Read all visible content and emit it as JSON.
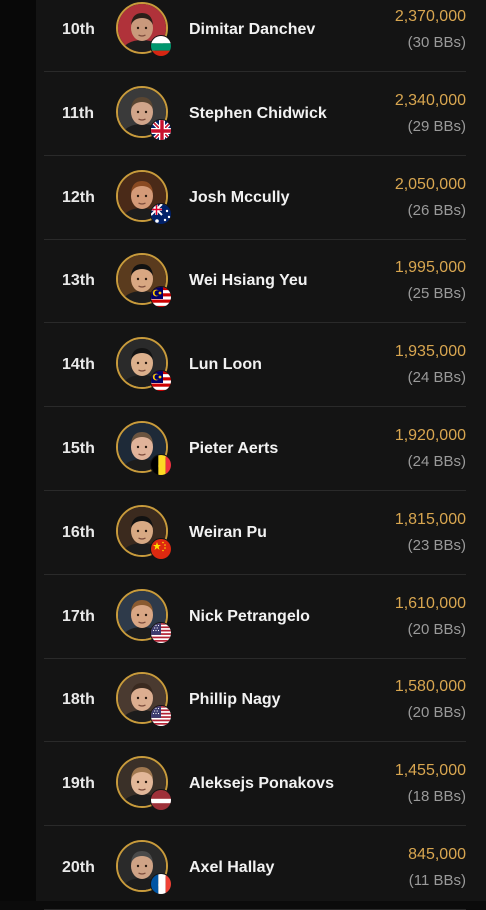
{
  "leaderboard": {
    "rows": [
      {
        "rank": "10th",
        "name": "Dimitar Danchev",
        "chips": "2,370,000",
        "bbs": "(30 BBs)",
        "flag": "bulgaria",
        "skin": "#c9997c",
        "hair": "#2b1f18",
        "bg": "#b0323a"
      },
      {
        "rank": "11th",
        "name": "Stephen Chidwick",
        "chips": "2,340,000",
        "bbs": "(29 BBs)",
        "flag": "uk",
        "skin": "#d1a58a",
        "hair": "#5a4632",
        "bg": "#3a3a3a"
      },
      {
        "rank": "12th",
        "name": "Josh Mccully",
        "chips": "2,050,000",
        "bbs": "(26 BBs)",
        "flag": "australia",
        "skin": "#d49a78",
        "hair": "#8a4a22",
        "bg": "#4a2a18"
      },
      {
        "rank": "13th",
        "name": "Wei Hsiang Yeu",
        "chips": "1,995,000",
        "bbs": "(25 BBs)",
        "flag": "malaysia",
        "skin": "#d8a782",
        "hair": "#111111",
        "bg": "#5a3b1e"
      },
      {
        "rank": "14th",
        "name": "Lun Loon",
        "chips": "1,935,000",
        "bbs": "(24 BBs)",
        "flag": "malaysia",
        "skin": "#dcb08c",
        "hair": "#141414",
        "bg": "#2a2a2a"
      },
      {
        "rank": "15th",
        "name": "Pieter Aerts",
        "chips": "1,920,000",
        "bbs": "(24 BBs)",
        "flag": "belgium",
        "skin": "#e0b39a",
        "hair": "#6b5440",
        "bg": "#1e2a38"
      },
      {
        "rank": "16th",
        "name": "Weiran Pu",
        "chips": "1,815,000",
        "bbs": "(23 BBs)",
        "flag": "china",
        "skin": "#d8a983",
        "hair": "#121212",
        "bg": "#3b2a1e"
      },
      {
        "rank": "17th",
        "name": "Nick Petrangelo",
        "chips": "1,610,000",
        "bbs": "(20 BBs)",
        "flag": "usa",
        "skin": "#d9a684",
        "hair": "#8a5a30",
        "bg": "#2e3a4a"
      },
      {
        "rank": "18th",
        "name": "Phillip Nagy",
        "chips": "1,580,000",
        "bbs": "(20 BBs)",
        "flag": "usa",
        "skin": "#dcae90",
        "hair": "#3a2a20",
        "bg": "#4a3a30"
      },
      {
        "rank": "19th",
        "name": "Aleksejs Ponakovs",
        "chips": "1,455,000",
        "bbs": "(18 BBs)",
        "flag": "latvia",
        "skin": "#e2b799",
        "hair": "#a07850",
        "bg": "#3a3028"
      },
      {
        "rank": "20th",
        "name": "Axel Hallay",
        "chips": "845,000",
        "bbs": "(11 BBs)",
        "flag": "france",
        "skin": "#cfa386",
        "hair": "#4a4a4a",
        "bg": "#2a2a2a"
      }
    ]
  },
  "colors": {
    "accent_gold": "#d8a650",
    "avatar_border": "#c89b3c",
    "muted_text": "#9a9a9a"
  }
}
